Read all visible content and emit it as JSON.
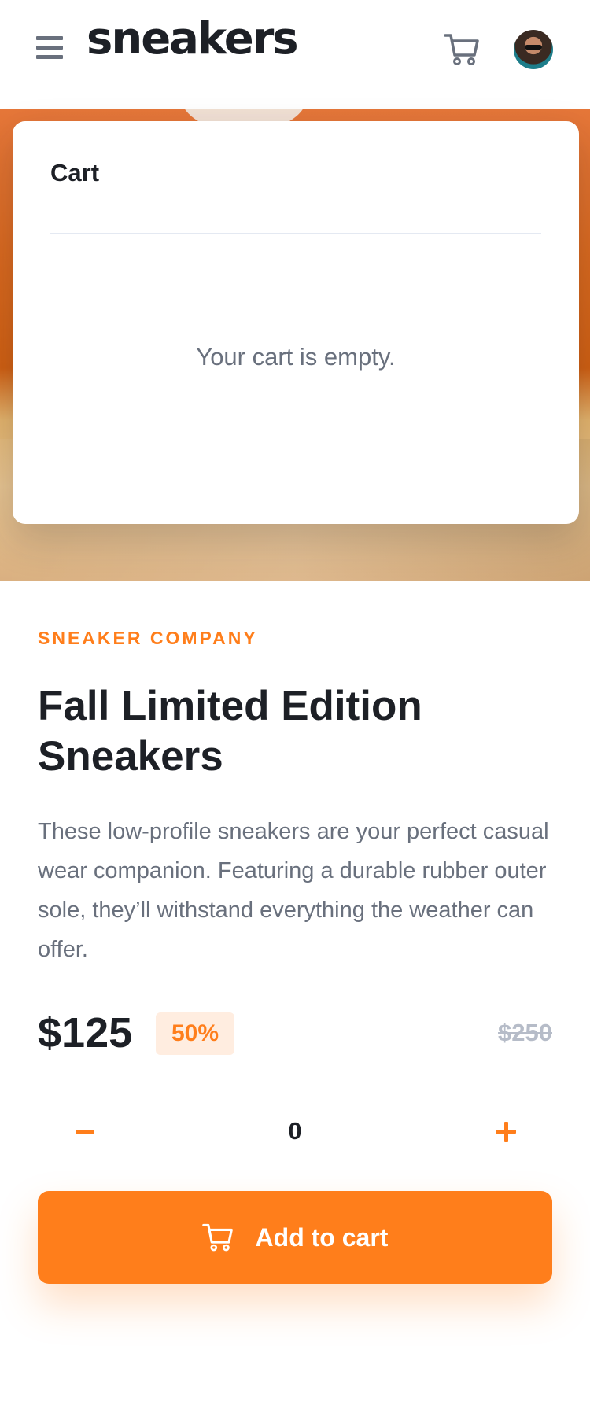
{
  "header": {
    "logo": "sneakers",
    "menu_icon": "hamburger-menu-icon",
    "cart_icon": "cart-icon",
    "avatar": "user-avatar"
  },
  "cart": {
    "title": "Cart",
    "empty_message": "Your cart is empty."
  },
  "product": {
    "company": "SNEAKER COMPANY",
    "title": "Fall Limited Edition Sneakers",
    "description": "These low-profile sneakers are your perfect casual wear companion. Featuring a durable rubber outer sole, they’ll withstand everything the weather can offer.",
    "price": "$125",
    "discount": "50%",
    "original_price": "$250"
  },
  "quantity": {
    "value": "0",
    "minus_icon": "minus-icon",
    "plus_icon": "plus-icon"
  },
  "add_to_cart": {
    "label": "Add to cart",
    "icon": "cart-icon"
  },
  "colors": {
    "accent": "#ff7e1b",
    "accent_pale": "#ffede0",
    "dark": "#1d2026",
    "grey": "#69707d",
    "grey_light": "#b6bcc8"
  }
}
